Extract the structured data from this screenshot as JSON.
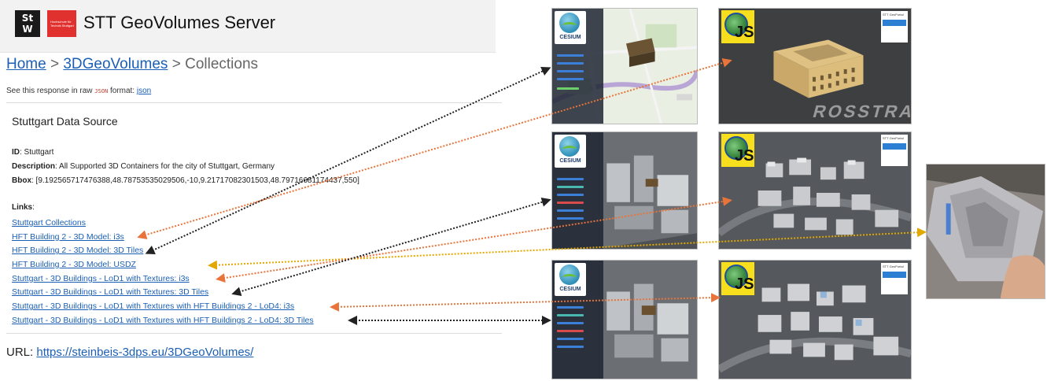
{
  "header": {
    "logo_left_text": "St\nW",
    "logo_right_text": "Hochschule für Technik Stuttgart",
    "title": "STT GeoVolumes Server"
  },
  "breadcrumb": {
    "home": "Home",
    "sep1": ">",
    "mid": "3DGeoVolumes",
    "sep2": ">",
    "current": "Collections"
  },
  "raw": {
    "prefix": "See this response in raw",
    "code": "JSON",
    "middle": "format:",
    "link": "json"
  },
  "collection": {
    "title": "Stuttgart Data Source",
    "id_label": "ID",
    "id_value": ": Stuttgart",
    "desc_label": "Description",
    "desc_value": ": All Supported 3D Containers for the city of Stuttgart, Germany",
    "bbox_label": "Bbox",
    "bbox_value": ": [9.192565717476388,48.78753535029506,-10,9.21717082301503,48.79716681174437,550]"
  },
  "links": {
    "label": "Links",
    "colon": ":",
    "items": [
      "Stuttgart Collections",
      "HFT Building 2 - 3D Model: i3s",
      "HFT Building 2 - 3D Model: 3D Tiles",
      "HFT Building 2 - 3D Model: USDZ",
      "Stuttgart - 3D Buildings - LoD1 with Textures: i3s",
      "Stuttgart - 3D Buildings - LoD1 with Textures: 3D Tiles",
      "Stuttgart - 3D Buildings - LoD1 with Textures with HFT Buildings 2 - LoD4: i3s",
      "Stuttgart - 3D Buildings - LoD1 with Textures with HFT Buildings 2 - LoD4: 3D Tiles"
    ]
  },
  "url": {
    "label": "URL:",
    "link": "https://steinbeis-3dps.eu/3DGeoVolumes/"
  },
  "thumbnails": {
    "cesium_label": "CESIUM",
    "js_label": "JS",
    "geo_panel_text": "STT GeoPortal",
    "street_text": "ROSSTRASSE"
  },
  "colors": {
    "link": "#1a5fb4",
    "arrow_black": "#222222",
    "arrow_orange": "#e8743b",
    "arrow_yellow": "#e0a800"
  }
}
